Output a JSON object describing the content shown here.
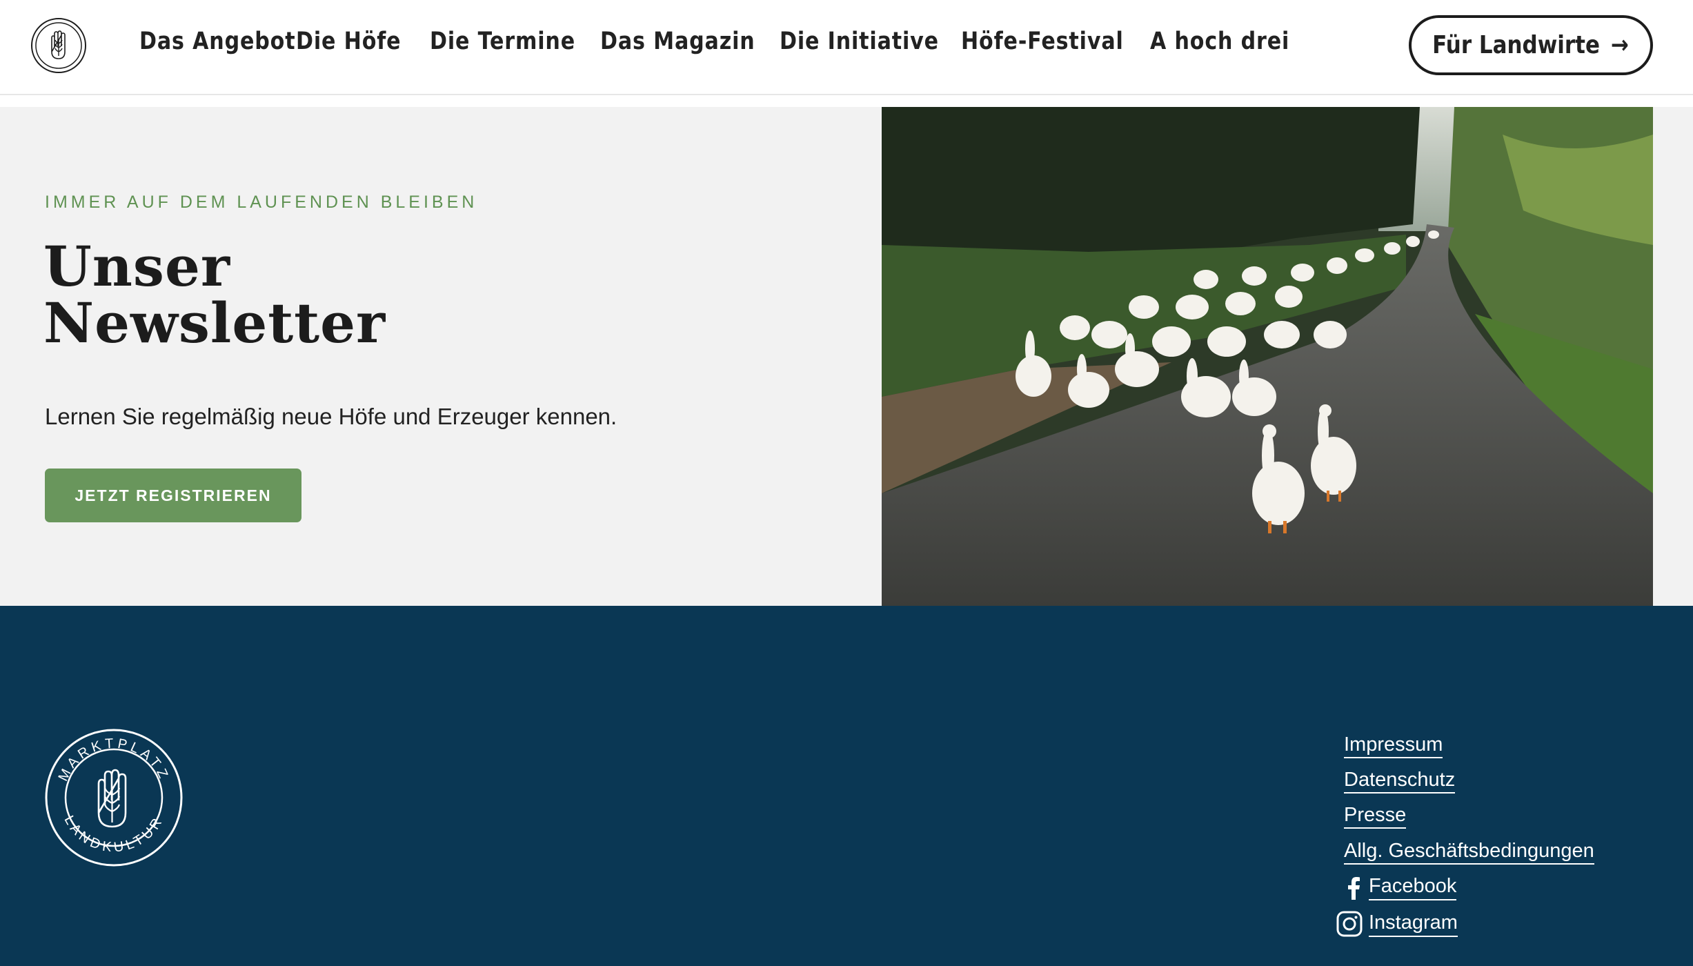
{
  "header": {
    "nav": [
      {
        "label": "Das Angebot"
      },
      {
        "label": "Die Höfe"
      },
      {
        "label": "Die Termine"
      },
      {
        "label": "Das Magazin"
      },
      {
        "label": "Die Initiative"
      },
      {
        "label": "Höfe-Festival"
      },
      {
        "label": "A hoch drei"
      }
    ],
    "cta_label": "Für Landwirte",
    "cta_arrow": "→"
  },
  "newsletter": {
    "eyebrow": "IMMER AUF DEM LAUFENDEN BLEIBEN",
    "title_line1": "Unser",
    "title_line2": "Newsletter",
    "lead": "Lernen Sie regelmäßig neue Höfe und Erzeuger kennen.",
    "button_label": "JETZT REGISTRIEREN",
    "image_subject": "flock of white geese walking on a country road"
  },
  "footer": {
    "logo_text_top": "MARKTPLATZ",
    "logo_text_bottom": "LANDKULTUR",
    "links": [
      {
        "label": "Impressum"
      },
      {
        "label": "Datenschutz"
      },
      {
        "label": "Presse"
      },
      {
        "label": "Allg. Geschäftsbedingungen"
      }
    ],
    "social": [
      {
        "label": "Facebook",
        "icon": "facebook-icon"
      },
      {
        "label": "Instagram",
        "icon": "instagram-icon"
      }
    ]
  },
  "colors": {
    "accent_green": "#69965c",
    "eyebrow_green": "#5f9252",
    "footer_navy": "#0a3754",
    "section_gray": "#f2f2f2",
    "text_dark": "#1c1c1c"
  }
}
